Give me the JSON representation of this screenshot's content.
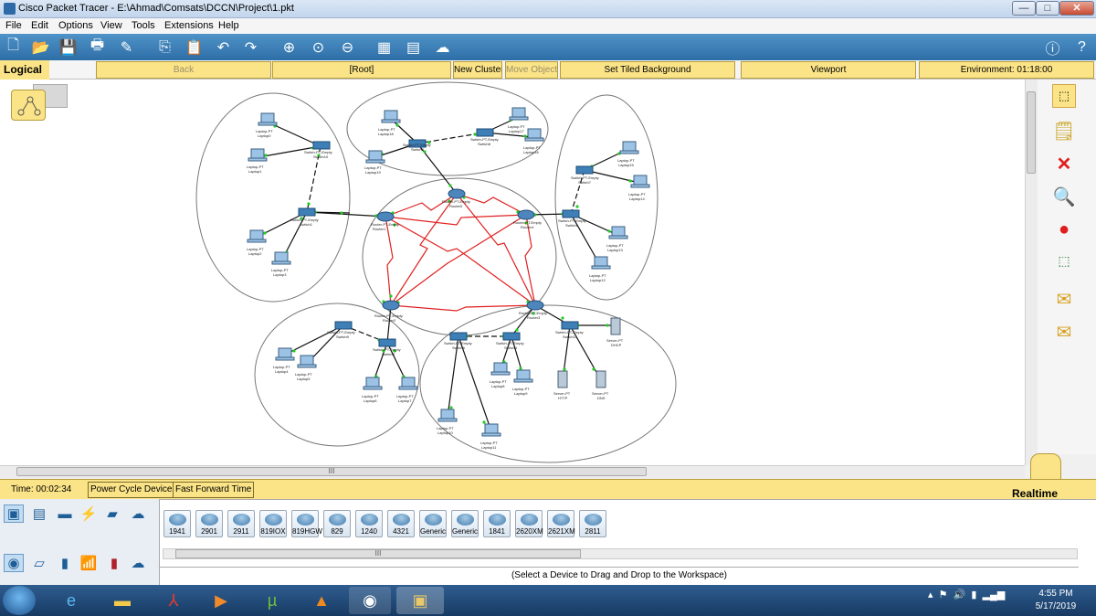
{
  "window": {
    "title": "Cisco Packet Tracer - E:\\Ahmad\\Comsats\\DCCN\\Project\\1.pkt",
    "buttons": {
      "minimize": "—",
      "maximize": "□",
      "close": "✕"
    }
  },
  "menu": [
    "File",
    "Edit",
    "Options",
    "View",
    "Tools",
    "Extensions",
    "Help"
  ],
  "logical_bar": {
    "tab_label": "Logical",
    "back": "Back",
    "root": "[Root]",
    "new_cluster": "New Cluster",
    "move_object": "Move Object",
    "set_tiled_background": "Set Tiled Background",
    "viewport": "Viewport",
    "environment": "Environment: 01:18:00"
  },
  "time_bar": {
    "time": "Time: 00:02:34",
    "power_cycle": "Power Cycle Devices",
    "fast_forward": "Fast Forward Time",
    "mode": "Realtime"
  },
  "devices": [
    "1941",
    "2901",
    "2911",
    "819IOX",
    "819HGW",
    "829",
    "1240",
    "4321",
    "Generic",
    "Generic",
    "1841",
    "2620XM",
    "2621XM",
    "2811"
  ],
  "hint": "(Select a Device to Drag and Drop to the Workspace)",
  "scroll_markers": {
    "h": "III",
    "dev": "III"
  },
  "taskbar": {
    "time": "4:55 PM",
    "date": "5/17/2019"
  },
  "network": {
    "routers": [
      {
        "name": "Router-PT-Empty",
        "label": "Router0"
      },
      {
        "name": "Router-PT-Empty",
        "label": "Router4"
      },
      {
        "name": "Router-PT-Empty",
        "label": "Router3"
      },
      {
        "name": "Router-PT-Empty",
        "label": "Router2"
      },
      {
        "name": "Router-PT-Empty",
        "label": "Router1"
      }
    ],
    "switches": [
      "Switch0",
      "Switch1",
      "Switch2",
      "Switch3",
      "Switch4",
      "Switch5",
      "Switch6",
      "Switch7",
      "Switch8",
      "Switch9",
      "Switch10",
      "Switch11"
    ],
    "laptops": [
      "Laptop0",
      "Laptop1",
      "Laptop2",
      "Laptop3",
      "Laptop4",
      "Laptop5",
      "Laptop6",
      "Laptop7",
      "Laptop8",
      "Laptop9",
      "Laptop10",
      "Laptop11",
      "Laptop12",
      "Laptop13",
      "Laptop14",
      "Laptop15",
      "Laptop16",
      "Laptop17",
      "Laptop18",
      "Laptop19"
    ],
    "servers": [
      "DHCP",
      "HTTP",
      "DNS"
    ],
    "device_type_laptop": "Laptop-PT",
    "device_type_switch": "Switch-PT-Empty",
    "device_type_server": "Server-PT"
  },
  "colors": {
    "accent_yellow": "#fbe487",
    "toolbar_blue": "#2d6ea6",
    "serial_link": "#e02020",
    "ethernet_link": "#111111",
    "link_light": "#22cc22"
  }
}
